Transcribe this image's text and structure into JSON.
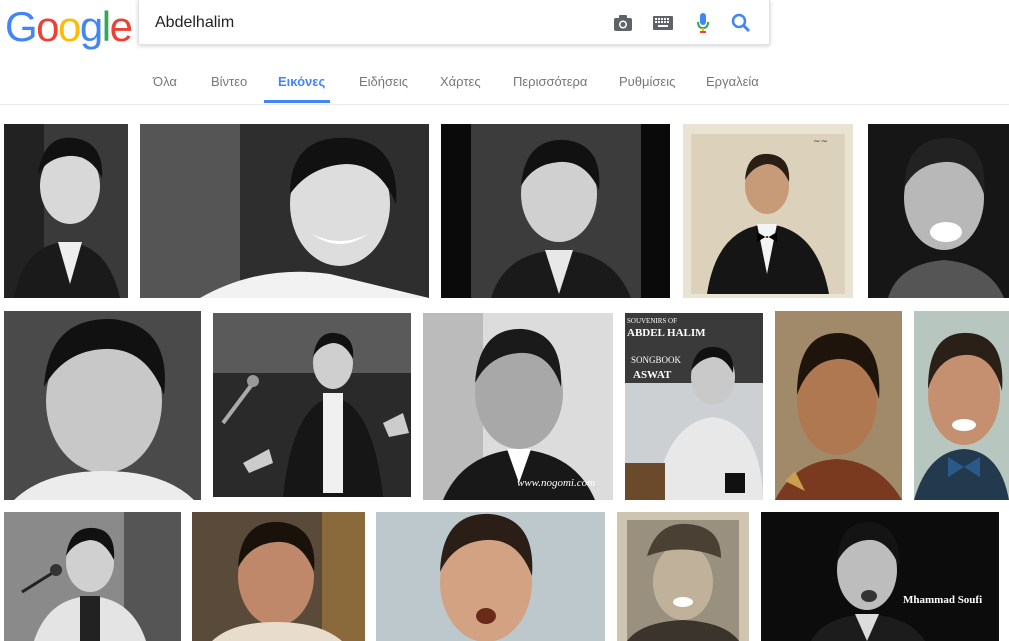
{
  "logo": {
    "letters": [
      "G",
      "o",
      "o",
      "g",
      "l",
      "e"
    ],
    "colors": [
      "#4285f4",
      "#ea4335",
      "#fbbc05",
      "#4285f4",
      "#34a853",
      "#ea4335"
    ]
  },
  "search": {
    "query": "Abdelhalim"
  },
  "icons": [
    "camera-icon",
    "keyboard-icon",
    "microphone-icon",
    "search-icon"
  ],
  "tabs": [
    {
      "label": "Όλα"
    },
    {
      "label": "Βίντεο"
    },
    {
      "label": "Εικόνες",
      "active": true
    },
    {
      "label": "Ειδήσεις"
    },
    {
      "label": "Χάρτες"
    },
    {
      "label": "Περισσότερα"
    },
    {
      "label": "Ρυθμίσεις"
    },
    {
      "label": "Εργαλεία"
    }
  ],
  "images": {
    "row1": [
      "bw-portrait",
      "bw-smiling",
      "bw-portrait-2",
      "color-tuxedo-record-cover",
      "bw-laughing"
    ],
    "row2": [
      "bw-closeup",
      "bw-singing-microphone",
      "bw-profile-smiling",
      "songbook-cover",
      "color-portrait",
      "color-portrait-bowtie"
    ],
    "row3": [
      "bw-singing-stage",
      "color-portrait-2",
      "color-singing",
      "sepia-portrait-cap",
      "bw-singing-portrait"
    ]
  },
  "watermarks": {
    "nogomi": "www.nogomi.com",
    "soufi": "Mhammad Soufi",
    "songbook_line1": "SOUVENIRS OF",
    "songbook_line2": "ABDEL HALIM",
    "songbook_line3": "SONGBOOK",
    "songbook_line4": "ASWAT"
  },
  "colors": {
    "accent": "#4285f4",
    "tab_text": "#777777"
  }
}
